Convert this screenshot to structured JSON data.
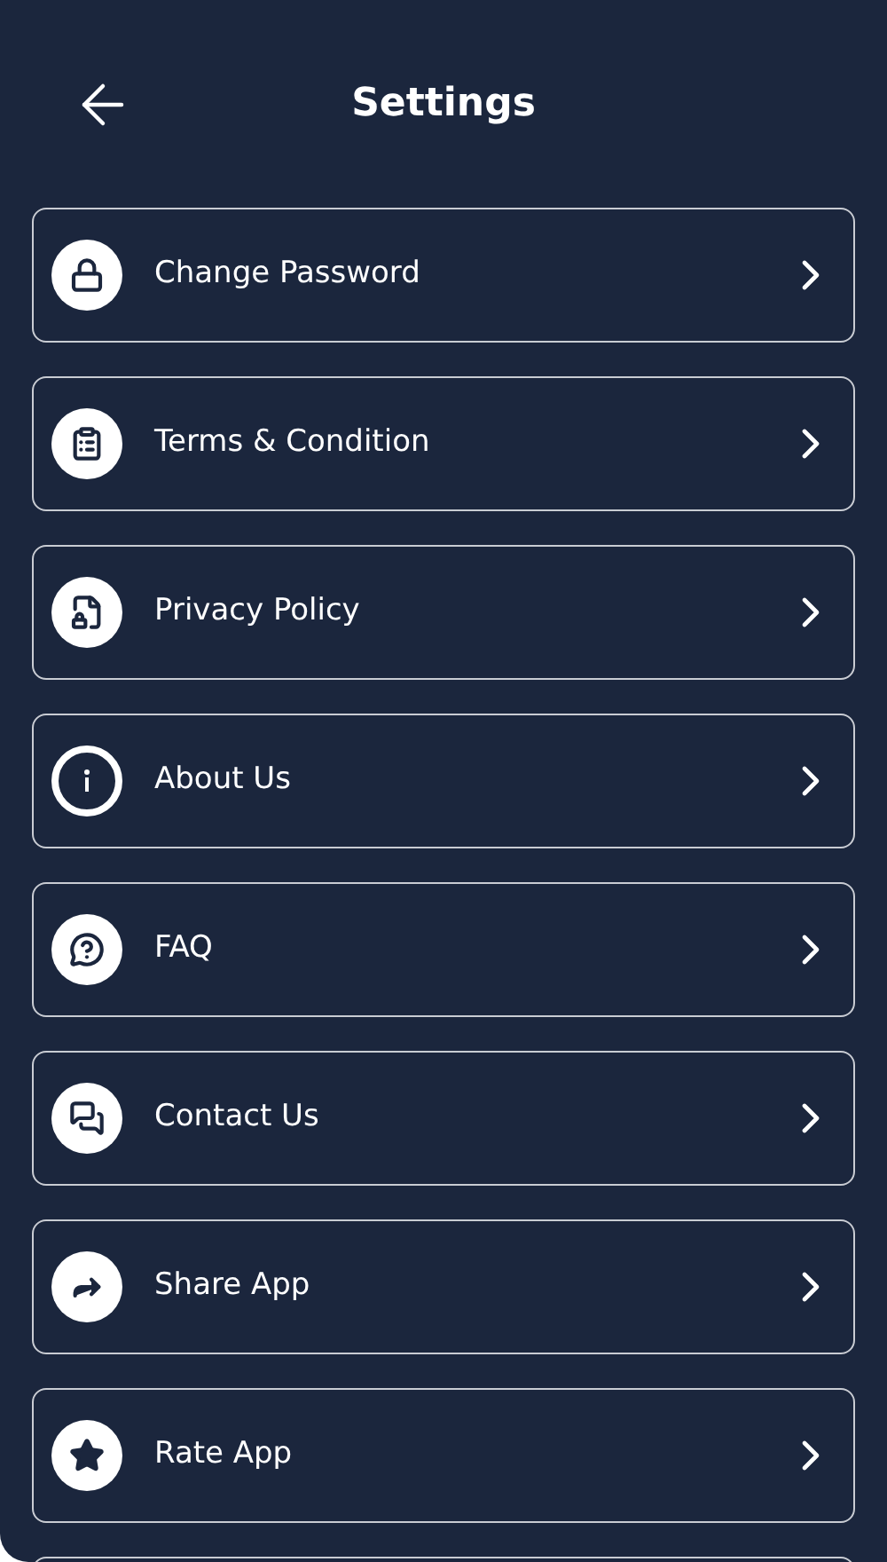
{
  "header": {
    "title": "Settings"
  },
  "items": [
    {
      "label": "Change Password",
      "kind": "lock"
    },
    {
      "label": "Terms & Condition",
      "kind": "clipboard"
    },
    {
      "label": "Privacy Policy",
      "kind": "document"
    },
    {
      "label": "About Us",
      "kind": "info"
    },
    {
      "label": "FAQ",
      "kind": "faq"
    },
    {
      "label": "Contact Us",
      "kind": "chat"
    },
    {
      "label": "Share App",
      "kind": "share"
    },
    {
      "label": "Rate App",
      "kind": "star"
    }
  ]
}
